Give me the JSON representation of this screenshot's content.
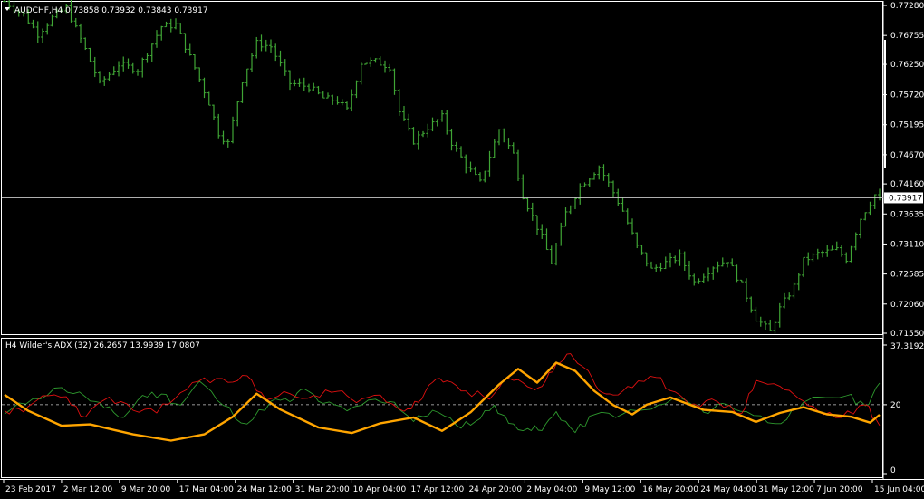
{
  "main_chart": {
    "title": "AUDCHF,H4  0.73858 0.73932 0.73843 0.73917",
    "menu_icon": "triangle-down-icon",
    "current_price_label": "0.73917",
    "colors": {
      "background": "#000000",
      "bars": "#3fa535",
      "axis": "#ffffff",
      "price_line": "#c8c8c8",
      "price_box_bg": "#ffffff",
      "price_box_text": "#000000"
    }
  },
  "indicator": {
    "title": "H4 Wilder's  ADX (32) 26.2657 13.9939 17.0807",
    "colors": {
      "adx": "#ffa500",
      "plus_di": "#2e9a2e",
      "minus_di": "#e01010",
      "level": "#c8c8c8"
    }
  },
  "time_labels": [
    "23 Feb 2017",
    "2 Mar 12:00",
    "9 Mar 20:00",
    "17 Mar 04:00",
    "24 Mar 12:00",
    "31 Mar 20:00",
    "10 Apr 04:00",
    "17 Apr 12:00",
    "24 Apr 20:00",
    "2 May 04:00",
    "9 May 12:00",
    "16 May 20:00",
    "24 May 04:00",
    "31 May 12:00",
    "7 Jun 20:00",
    "15 Jun 04:00"
  ],
  "chart_data": [
    {
      "type": "bar",
      "name": "AUDCHF,H4",
      "ohlc": {
        "open": 0.73858,
        "high": 0.73932,
        "low": 0.73843,
        "close": 0.73917
      },
      "ylim": [
        0.7155,
        0.7728
      ],
      "y_ticks": [
        0.7728,
        0.76755,
        0.7625,
        0.7572,
        0.75195,
        0.7467,
        0.7416,
        0.73635,
        0.7311,
        0.72585,
        0.7206,
        0.7155
      ],
      "y_tick_labels": [
        "0.77280",
        "0.76755",
        "0.76250",
        "0.75720",
        "0.75195",
        "0.74670",
        "0.74160",
        "0.73635",
        "0.73110",
        "0.72585",
        "0.72060",
        "0.71550"
      ],
      "current_price": 0.73917,
      "path": [
        {
          "x": 0,
          "y": 0.7735
        },
        {
          "x": 4,
          "y": 0.7712
        },
        {
          "x": 7,
          "y": 0.7678
        },
        {
          "x": 10,
          "y": 0.7706
        },
        {
          "x": 13,
          "y": 0.7724
        },
        {
          "x": 17,
          "y": 0.7651
        },
        {
          "x": 20,
          "y": 0.7591
        },
        {
          "x": 24,
          "y": 0.7625
        },
        {
          "x": 28,
          "y": 0.7616
        },
        {
          "x": 33,
          "y": 0.7691
        },
        {
          "x": 36,
          "y": 0.7694
        },
        {
          "x": 40,
          "y": 0.7619
        },
        {
          "x": 43,
          "y": 0.7558
        },
        {
          "x": 45,
          "y": 0.7505
        },
        {
          "x": 47,
          "y": 0.7487
        },
        {
          "x": 50,
          "y": 0.7598
        },
        {
          "x": 53,
          "y": 0.7662
        },
        {
          "x": 56,
          "y": 0.7656
        },
        {
          "x": 60,
          "y": 0.7592
        },
        {
          "x": 64,
          "y": 0.7586
        },
        {
          "x": 67,
          "y": 0.7566
        },
        {
          "x": 70,
          "y": 0.7561
        },
        {
          "x": 72,
          "y": 0.7545
        },
        {
          "x": 75,
          "y": 0.7628
        },
        {
          "x": 78,
          "y": 0.763
        },
        {
          "x": 81,
          "y": 0.7621
        },
        {
          "x": 83,
          "y": 0.7542
        },
        {
          "x": 86,
          "y": 0.7491
        },
        {
          "x": 89,
          "y": 0.7515
        },
        {
          "x": 92,
          "y": 0.7533
        },
        {
          "x": 94,
          "y": 0.7488
        },
        {
          "x": 97,
          "y": 0.7449
        },
        {
          "x": 100,
          "y": 0.7418
        },
        {
          "x": 104,
          "y": 0.7511
        },
        {
          "x": 107,
          "y": 0.7468
        },
        {
          "x": 109,
          "y": 0.7396
        },
        {
          "x": 113,
          "y": 0.7322
        },
        {
          "x": 115,
          "y": 0.7279
        },
        {
          "x": 118,
          "y": 0.7365
        },
        {
          "x": 121,
          "y": 0.7411
        },
        {
          "x": 125,
          "y": 0.7446
        },
        {
          "x": 127,
          "y": 0.7417
        },
        {
          "x": 130,
          "y": 0.7369
        },
        {
          "x": 133,
          "y": 0.7306
        },
        {
          "x": 136,
          "y": 0.7266
        },
        {
          "x": 139,
          "y": 0.7278
        },
        {
          "x": 142,
          "y": 0.7289
        },
        {
          "x": 145,
          "y": 0.7244
        },
        {
          "x": 149,
          "y": 0.7272
        },
        {
          "x": 152,
          "y": 0.7283
        },
        {
          "x": 155,
          "y": 0.7239
        },
        {
          "x": 158,
          "y": 0.7181
        },
        {
          "x": 161,
          "y": 0.7158
        },
        {
          "x": 163,
          "y": 0.7198
        },
        {
          "x": 166,
          "y": 0.7237
        },
        {
          "x": 168,
          "y": 0.7282
        },
        {
          "x": 171,
          "y": 0.7294
        },
        {
          "x": 175,
          "y": 0.7301
        },
        {
          "x": 177,
          "y": 0.7285
        },
        {
          "x": 180,
          "y": 0.7356
        },
        {
          "x": 183,
          "y": 0.7397
        },
        {
          "x": 184,
          "y": 0.7392
        }
      ],
      "x_unit": "H4 bar index (184 = last bar)"
    },
    {
      "type": "line",
      "name": "ADX (32)",
      "ylim": [
        0,
        37.3192
      ],
      "y_tick_labels": [
        "37.3192",
        "20",
        "0"
      ],
      "level": 20,
      "series": [
        {
          "name": "ADX",
          "points": [
            {
              "x": 0,
              "y": 22.9
            },
            {
              "x": 5,
              "y": 18.2
            },
            {
              "x": 12,
              "y": 13.9
            },
            {
              "x": 18,
              "y": 14.3
            },
            {
              "x": 27,
              "y": 11.4
            },
            {
              "x": 35,
              "y": 9.6
            },
            {
              "x": 42,
              "y": 11.4
            },
            {
              "x": 48,
              "y": 16.5
            },
            {
              "x": 53,
              "y": 23.2
            },
            {
              "x": 58,
              "y": 18.6
            },
            {
              "x": 66,
              "y": 13.4
            },
            {
              "x": 73,
              "y": 11.8
            },
            {
              "x": 79,
              "y": 14.6
            },
            {
              "x": 86,
              "y": 16.3
            },
            {
              "x": 92,
              "y": 12.4
            },
            {
              "x": 98,
              "y": 17.8
            },
            {
              "x": 104,
              "y": 25.9
            },
            {
              "x": 108,
              "y": 30.4
            },
            {
              "x": 112,
              "y": 26.4
            },
            {
              "x": 116,
              "y": 32.2
            },
            {
              "x": 120,
              "y": 29.8
            },
            {
              "x": 124,
              "y": 24.0
            },
            {
              "x": 128,
              "y": 19.9
            },
            {
              "x": 132,
              "y": 17.2
            },
            {
              "x": 135,
              "y": 20.0
            },
            {
              "x": 140,
              "y": 22.1
            },
            {
              "x": 147,
              "y": 18.5
            },
            {
              "x": 153,
              "y": 17.9
            },
            {
              "x": 158,
              "y": 15.0
            },
            {
              "x": 163,
              "y": 17.6
            },
            {
              "x": 168,
              "y": 19.3
            },
            {
              "x": 173,
              "y": 17.2
            },
            {
              "x": 178,
              "y": 16.5
            },
            {
              "x": 182,
              "y": 14.8
            },
            {
              "x": 184,
              "y": 17.08
            }
          ]
        },
        {
          "name": "+DI",
          "points": [
            {
              "x": 0,
              "y": 17.3
            },
            {
              "x": 6,
              "y": 21.8
            },
            {
              "x": 12,
              "y": 25.0
            },
            {
              "x": 17,
              "y": 22.3
            },
            {
              "x": 21,
              "y": 19.0
            },
            {
              "x": 25,
              "y": 16.3
            },
            {
              "x": 29,
              "y": 22.7
            },
            {
              "x": 33,
              "y": 23.1
            },
            {
              "x": 37,
              "y": 19.9
            },
            {
              "x": 41,
              "y": 26.8
            },
            {
              "x": 46,
              "y": 19.8
            },
            {
              "x": 51,
              "y": 14.4
            },
            {
              "x": 56,
              "y": 21.0
            },
            {
              "x": 60,
              "y": 20.9
            },
            {
              "x": 63,
              "y": 24.6
            },
            {
              "x": 67,
              "y": 20.4
            },
            {
              "x": 72,
              "y": 18.2
            },
            {
              "x": 78,
              "y": 21.6
            },
            {
              "x": 82,
              "y": 20.7
            },
            {
              "x": 86,
              "y": 15.1
            },
            {
              "x": 90,
              "y": 18.4
            },
            {
              "x": 95,
              "y": 14.0
            },
            {
              "x": 99,
              "y": 15.1
            },
            {
              "x": 103,
              "y": 19.9
            },
            {
              "x": 106,
              "y": 14.6
            },
            {
              "x": 110,
              "y": 13.1
            },
            {
              "x": 113,
              "y": 12.5
            },
            {
              "x": 116,
              "y": 18.0
            },
            {
              "x": 120,
              "y": 11.9
            },
            {
              "x": 124,
              "y": 17.1
            },
            {
              "x": 130,
              "y": 17.3
            },
            {
              "x": 136,
              "y": 18.7
            },
            {
              "x": 142,
              "y": 22.1
            },
            {
              "x": 147,
              "y": 17.8
            },
            {
              "x": 151,
              "y": 20.4
            },
            {
              "x": 156,
              "y": 18.0
            },
            {
              "x": 162,
              "y": 14.5
            },
            {
              "x": 167,
              "y": 18.9
            },
            {
              "x": 171,
              "y": 22.2
            },
            {
              "x": 177,
              "y": 22.6
            },
            {
              "x": 181,
              "y": 19.7
            },
            {
              "x": 184,
              "y": 26.27
            }
          ]
        },
        {
          "name": "-DI",
          "points": [
            {
              "x": 0,
              "y": 18.3
            },
            {
              "x": 4,
              "y": 17.9
            },
            {
              "x": 8,
              "y": 22.6
            },
            {
              "x": 13,
              "y": 22.3
            },
            {
              "x": 17,
              "y": 16.4
            },
            {
              "x": 22,
              "y": 22.2
            },
            {
              "x": 27,
              "y": 18.4
            },
            {
              "x": 32,
              "y": 17.6
            },
            {
              "x": 37,
              "y": 23.5
            },
            {
              "x": 42,
              "y": 27.8
            },
            {
              "x": 47,
              "y": 26.5
            },
            {
              "x": 51,
              "y": 28.4
            },
            {
              "x": 55,
              "y": 21.4
            },
            {
              "x": 60,
              "y": 23.2
            },
            {
              "x": 65,
              "y": 22.7
            },
            {
              "x": 70,
              "y": 23.9
            },
            {
              "x": 74,
              "y": 20.6
            },
            {
              "x": 79,
              "y": 22.8
            },
            {
              "x": 84,
              "y": 18.1
            },
            {
              "x": 87,
              "y": 20.7
            },
            {
              "x": 90,
              "y": 26.5
            },
            {
              "x": 93,
              "y": 26.9
            },
            {
              "x": 97,
              "y": 24.0
            },
            {
              "x": 102,
              "y": 21.6
            },
            {
              "x": 106,
              "y": 27.7
            },
            {
              "x": 110,
              "y": 25.2
            },
            {
              "x": 113,
              "y": 25.3
            },
            {
              "x": 116,
              "y": 31.8
            },
            {
              "x": 119,
              "y": 34.8
            },
            {
              "x": 122,
              "y": 30.6
            },
            {
              "x": 125,
              "y": 24.1
            },
            {
              "x": 128,
              "y": 22.8
            },
            {
              "x": 132,
              "y": 25.0
            },
            {
              "x": 137,
              "y": 27.9
            },
            {
              "x": 141,
              "y": 23.7
            },
            {
              "x": 145,
              "y": 20.2
            },
            {
              "x": 150,
              "y": 20.8
            },
            {
              "x": 155,
              "y": 17.5
            },
            {
              "x": 158,
              "y": 27.1
            },
            {
              "x": 163,
              "y": 25.4
            },
            {
              "x": 167,
              "y": 21.8
            },
            {
              "x": 171,
              "y": 18.2
            },
            {
              "x": 176,
              "y": 16.3
            },
            {
              "x": 181,
              "y": 20.0
            },
            {
              "x": 184,
              "y": 13.99
            }
          ]
        }
      ]
    }
  ]
}
